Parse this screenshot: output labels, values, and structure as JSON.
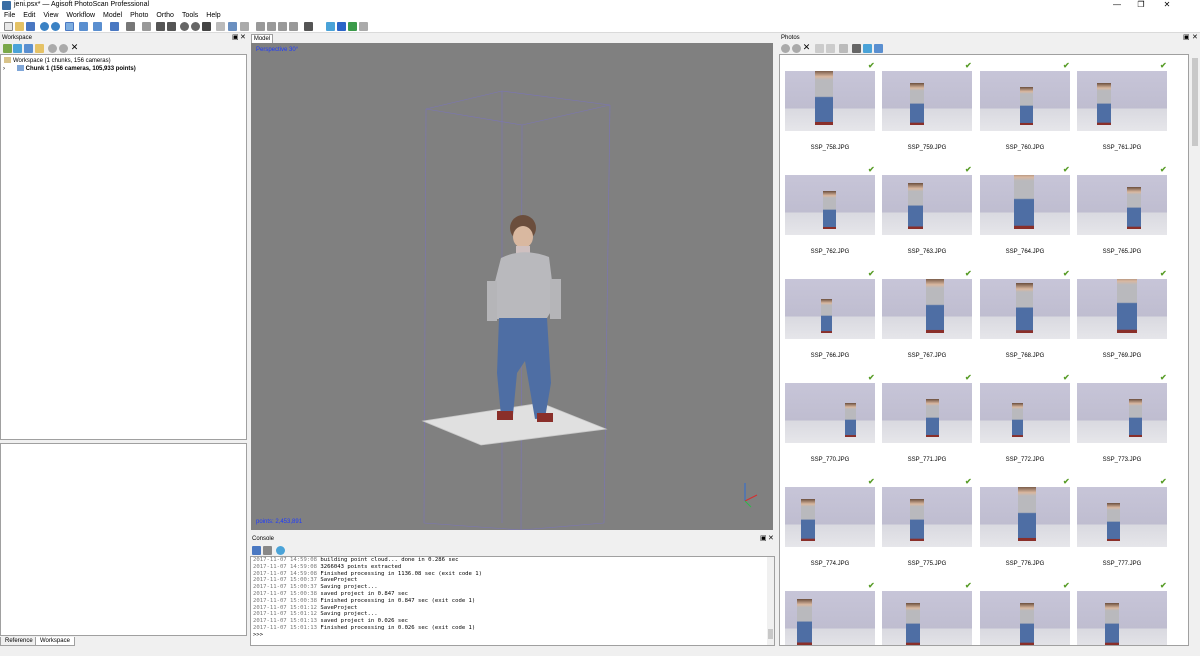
{
  "window": {
    "title": "jeni.psx* — Agisoft PhotoScan Professional"
  },
  "menu": [
    "File",
    "Edit",
    "View",
    "Workflow",
    "Model",
    "Photo",
    "Ortho",
    "Tools",
    "Help"
  ],
  "workspace": {
    "panel_title": "Workspace",
    "root": "Workspace (1 chunks, 156 cameras)",
    "chunk": "Chunk 1 (156 cameras, 105,933 points)"
  },
  "model": {
    "tab": "Model",
    "projection": "Perspective 30°",
    "points": "points: 2,453,891"
  },
  "console": {
    "panel_title": "Console",
    "lines": [
      {
        "ts": "2017-11-07 14:59:08",
        "msg": "building point cloud... done in 0.286 sec"
      },
      {
        "ts": "2017-11-07 14:59:08",
        "msg": "3266043 points extracted"
      },
      {
        "ts": "2017-11-07 14:59:08",
        "msg": "Finished processing in 1136.08 sec (exit code 1)"
      },
      {
        "ts": "2017-11-07 15:00:37",
        "msg": "SaveProject"
      },
      {
        "ts": "2017-11-07 15:00:37",
        "msg": "Saving project..."
      },
      {
        "ts": "2017-11-07 15:00:38",
        "msg": "saved project in 0.847 sec"
      },
      {
        "ts": "2017-11-07 15:00:38",
        "msg": "Finished processing in 0.847 sec (exit code 1)"
      },
      {
        "ts": "2017-11-07 15:01:12",
        "msg": "SaveProject"
      },
      {
        "ts": "2017-11-07 15:01:12",
        "msg": "Saving project..."
      },
      {
        "ts": "2017-11-07 15:01:13",
        "msg": "saved project in 0.026 sec"
      },
      {
        "ts": "2017-11-07 15:01:13",
        "msg": "Finished processing in 0.026 sec (exit code 1)"
      },
      {
        "ts": "",
        "msg": ">>>"
      }
    ]
  },
  "photos": {
    "panel_title": "Photos",
    "names": [
      "SSP_758.JPG",
      "SSP_759.JPG",
      "SSP_760.JPG",
      "SSP_761.JPG",
      "SSP_762.JPG",
      "SSP_763.JPG",
      "SSP_764.JPG",
      "SSP_765.JPG",
      "SSP_766.JPG",
      "SSP_767.JPG",
      "SSP_768.JPG",
      "SSP_769.JPG",
      "SSP_770.JPG",
      "SSP_771.JPG",
      "SSP_772.JPG",
      "SSP_773.JPG",
      "SSP_774.JPG",
      "SSP_775.JPG",
      "SSP_776.JPG",
      "SSP_777.JPG",
      "",
      "",
      "",
      ""
    ],
    "check_glyph": "✔"
  },
  "bottom_tabs": [
    "Reference",
    "Workspace"
  ],
  "colors": {
    "accent_blue": "#1c39ff",
    "check_green": "#5a9e2a",
    "viewport_gray": "#808080"
  }
}
